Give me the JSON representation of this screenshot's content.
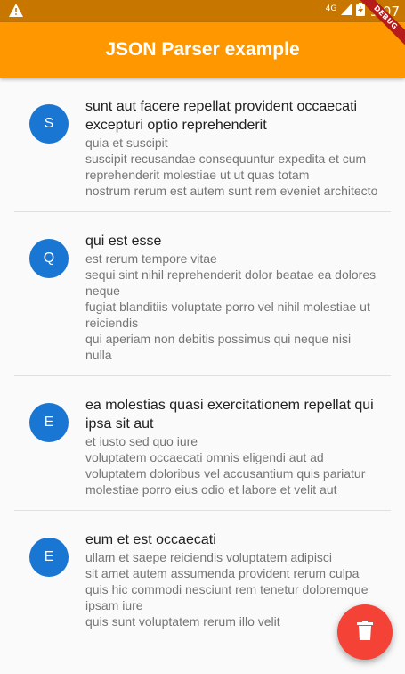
{
  "status_bar": {
    "network": "4G",
    "time": "9:07"
  },
  "app_bar": {
    "title": "JSON Parser example",
    "debug_banner": "DEBUG"
  },
  "posts": [
    {
      "initial": "S",
      "title": "sunt aut facere repellat provident occaecati excepturi optio reprehenderit",
      "body": "quia et suscipit\nsuscipit recusandae consequuntur expedita et cum\nreprehenderit molestiae ut ut quas totam\nnostrum rerum est autem sunt rem eveniet architecto"
    },
    {
      "initial": "Q",
      "title": "qui est esse",
      "body": "est rerum tempore vitae\nsequi sint nihil reprehenderit dolor beatae ea dolores neque\nfugiat blanditiis voluptate porro vel nihil molestiae ut reiciendis\nqui aperiam non debitis possimus qui neque nisi nulla"
    },
    {
      "initial": "E",
      "title": "ea molestias quasi exercitationem repellat qui ipsa sit aut",
      "body": "et iusto sed quo iure\nvoluptatem occaecati omnis eligendi aut ad\nvoluptatem doloribus vel accusantium quis pariatur\nmolestiae porro eius odio et labore et velit aut"
    },
    {
      "initial": "E",
      "title": "eum et est occaecati",
      "body": "ullam et saepe reiciendis voluptatem adipisci\nsit amet autem assumenda provident rerum culpa\nquis hic commodi nesciunt rem tenetur doloremque ipsam iure\nquis sunt voluptatem rerum illo velit"
    }
  ],
  "fab": {
    "icon": "delete-icon"
  },
  "colors": {
    "status_bar": "#c77700",
    "app_bar": "#ff9800",
    "avatar": "#1976d2",
    "fab": "#f44336",
    "debug_ribbon": "#b71c1c"
  }
}
